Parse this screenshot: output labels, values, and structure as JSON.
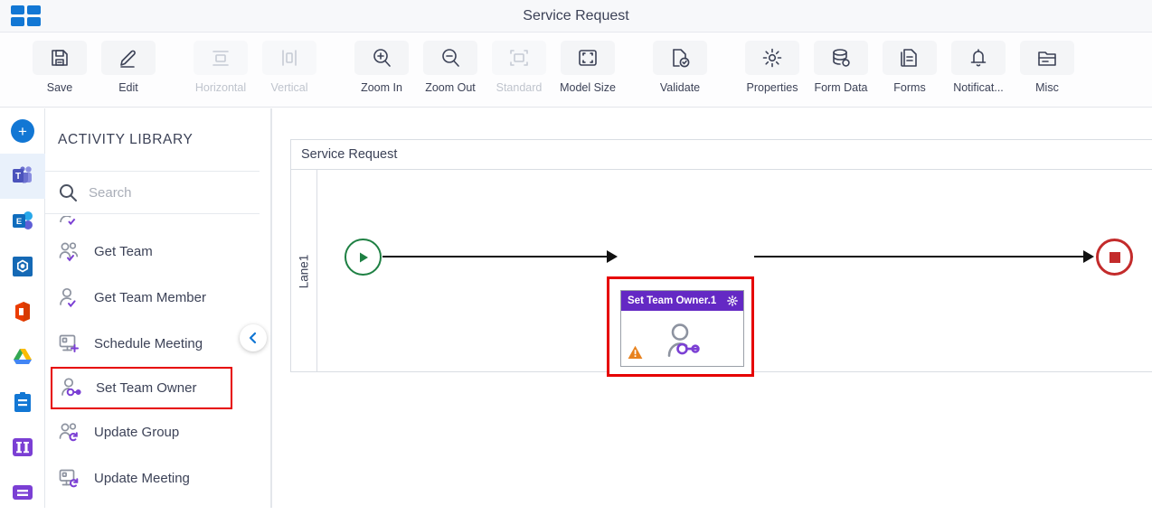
{
  "titlebar": {
    "logo": "apps-grid-icon",
    "title": "Service Request"
  },
  "toolbar": {
    "groups": [
      {
        "items": [
          {
            "label": "Save",
            "icon": "save-icon",
            "disabled": false
          },
          {
            "label": "Edit",
            "icon": "pencil-icon",
            "disabled": false
          }
        ]
      },
      {
        "items": [
          {
            "label": "Horizontal",
            "icon": "align-horizontal-icon",
            "disabled": true
          },
          {
            "label": "Vertical",
            "icon": "align-vertical-icon",
            "disabled": true
          }
        ]
      },
      {
        "items": [
          {
            "label": "Zoom In",
            "icon": "zoom-in-icon",
            "disabled": false
          },
          {
            "label": "Zoom Out",
            "icon": "zoom-out-icon",
            "disabled": false
          },
          {
            "label": "Standard",
            "icon": "standard-size-icon",
            "disabled": true
          },
          {
            "label": "Model Size",
            "icon": "model-size-icon",
            "disabled": false
          }
        ]
      },
      {
        "items": [
          {
            "label": "Validate",
            "icon": "validate-icon",
            "disabled": false
          }
        ]
      },
      {
        "items": [
          {
            "label": "Properties",
            "icon": "gear-icon",
            "disabled": false
          },
          {
            "label": "Form Data",
            "icon": "database-icon",
            "disabled": false
          },
          {
            "label": "Forms",
            "icon": "document-icon",
            "disabled": false
          },
          {
            "label": "Notificat...",
            "icon": "bell-icon",
            "disabled": false
          },
          {
            "label": "Misc",
            "icon": "folder-icon",
            "disabled": false
          }
        ]
      }
    ]
  },
  "rail": {
    "items": [
      {
        "name": "add-app-button",
        "icon": "plus-circle-icon",
        "active": false
      },
      {
        "name": "microsoft-teams",
        "icon": "teams-icon",
        "active": true
      },
      {
        "name": "exchange",
        "icon": "exchange-icon",
        "active": false
      },
      {
        "name": "sharepoint",
        "icon": "sharepoint-icon",
        "active": false
      },
      {
        "name": "office",
        "icon": "office-icon",
        "active": false
      },
      {
        "name": "google-drive",
        "icon": "google-drive-icon",
        "active": false
      },
      {
        "name": "tasks",
        "icon": "clipboard-icon",
        "active": false
      },
      {
        "name": "integrations",
        "icon": "columns-icon",
        "active": false
      },
      {
        "name": "lists",
        "icon": "list-icon",
        "active": false
      }
    ]
  },
  "library": {
    "heading": "ACTIVITY LIBRARY",
    "search": {
      "value": "",
      "placeholder": "Search",
      "icon": "search-icon"
    },
    "collapse_button": "chevron-left-icon",
    "items": [
      {
        "label": "",
        "icon": "person-check-icon",
        "clipped": true,
        "selected": false
      },
      {
        "label": "Get Team",
        "icon": "people-check-icon",
        "clipped": false,
        "selected": false
      },
      {
        "label": "Get Team Member",
        "icon": "person-check-icon",
        "clipped": false,
        "selected": false
      },
      {
        "label": "Schedule Meeting",
        "icon": "meeting-add-icon",
        "clipped": false,
        "selected": false
      },
      {
        "label": "Set Team Owner",
        "icon": "person-key-icon",
        "clipped": false,
        "selected": true
      },
      {
        "label": "Update Group",
        "icon": "people-refresh-icon",
        "clipped": false,
        "selected": false
      },
      {
        "label": "Update Meeting",
        "icon": "meeting-refresh-icon",
        "clipped": false,
        "selected": false
      }
    ]
  },
  "canvas": {
    "pool_title": "Service Request",
    "lane_label": "Lane1",
    "start_node": {
      "name": "start-event",
      "icon": "play-icon"
    },
    "end_node": {
      "name": "end-event",
      "icon": "stop-square-icon"
    },
    "task": {
      "title": "Set Team Owner.1",
      "gear": "gear-icon",
      "warning": "warning-triangle-icon",
      "glyph": "person-key-icon",
      "selected": true
    }
  },
  "colors": {
    "accent_blue": "#1277d4",
    "task_header_purple": "#6429c4",
    "selection_red": "#e60000",
    "start_green": "#1e8043",
    "end_red": "#c32b2b",
    "warning_orange": "#e8821e",
    "activity_icon_purple": "#7b3fd4"
  }
}
